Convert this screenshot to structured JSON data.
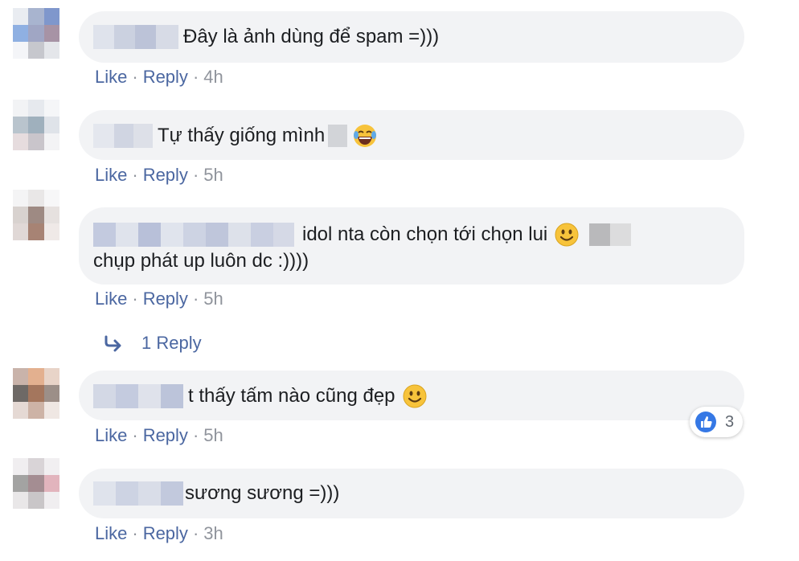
{
  "comments": [
    {
      "text": "Đây là ảnh dùng để spam =)))",
      "actions": {
        "like": "Like",
        "reply": "Reply",
        "time": "4h"
      }
    },
    {
      "text": "Tự thấy giống mình",
      "emoji": "grinning-tears-emoji",
      "actions": {
        "like": "Like",
        "reply": "Reply",
        "time": "5h"
      }
    },
    {
      "text_line1": "idol nta còn chọn tới chọn lui",
      "text_line2": "chụp phát up luôn dc :))))",
      "emoji": "smiling-face-emoji",
      "actions": {
        "like": "Like",
        "reply": "Reply",
        "time": "5h"
      }
    },
    {
      "text": "t thấy tấm nào cũng đẹp",
      "emoji": "smiling-face-emoji",
      "reaction_count": "3",
      "actions": {
        "like": "Like",
        "reply": "Reply",
        "time": "5h"
      }
    },
    {
      "text": "sương sương =)))",
      "actions": {
        "like": "Like",
        "reply": "Reply",
        "time": "3h"
      }
    }
  ],
  "replies_link": "1 Reply",
  "separator": "·",
  "colors": {
    "link": "#4b67a1",
    "bubble": "#f2f3f5",
    "meta": "#90949c",
    "like_blue": "#3578e5"
  }
}
